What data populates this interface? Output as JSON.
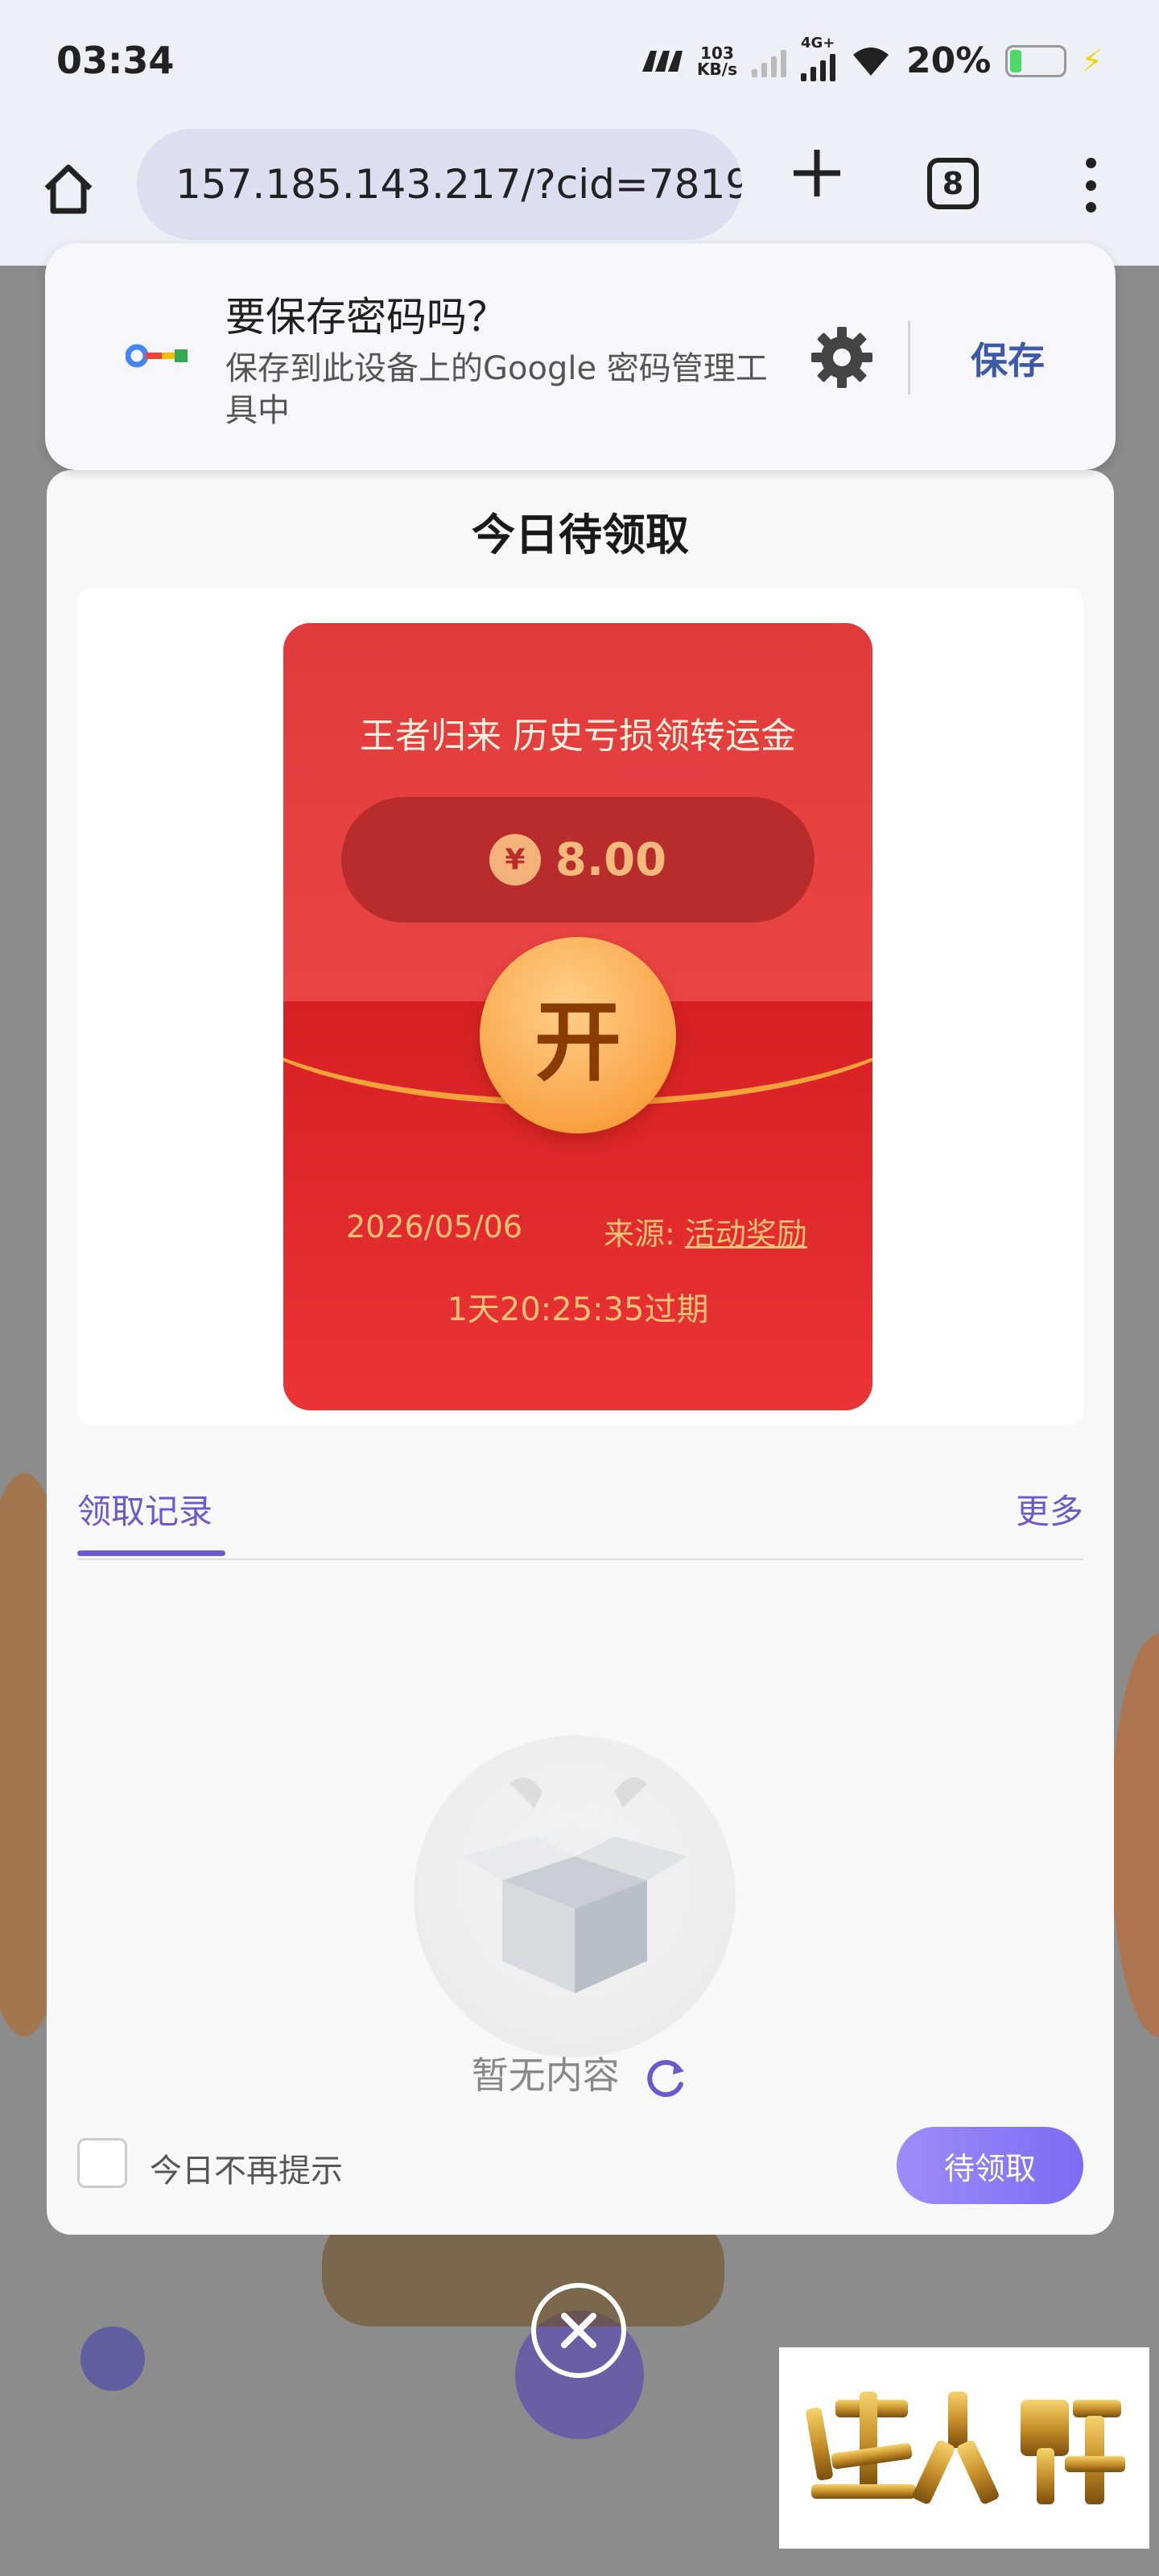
{
  "status_bar": {
    "time": "03:34",
    "net_speed_value": "103",
    "net_speed_unit": "KB/s",
    "network_type": "4G+",
    "battery_percent": "20%",
    "battery_level": 0.2
  },
  "browser": {
    "url": "157.185.143.217/?cid=7819",
    "tab_count": "8"
  },
  "password_prompt": {
    "title": "要保存密码吗？",
    "subtitle": "保存到此设备上的Google 密码管理工具中",
    "save_label": "保存"
  },
  "modal": {
    "title": "今日待领取",
    "red_packet": {
      "headline": "王者归来 历史亏损领转运金",
      "currency_symbol": "¥",
      "amount": "8.00",
      "open_label": "开",
      "date": "2026/05/06",
      "source_label": "来源:",
      "source_value": "活动奖励",
      "expire_text": "1天20:25:35过期"
    },
    "tabs": {
      "records_label": "领取记录",
      "more_label": "更多"
    },
    "empty_text": "暂无内容",
    "dont_remind_label": "今日不再提示",
    "pending_button_label": "待领取"
  },
  "watermark": {
    "text": "迷人牌"
  },
  "colors": {
    "accent": "#6a5acd",
    "packet_red": "#e13a3c",
    "gold": "#fcc276"
  }
}
